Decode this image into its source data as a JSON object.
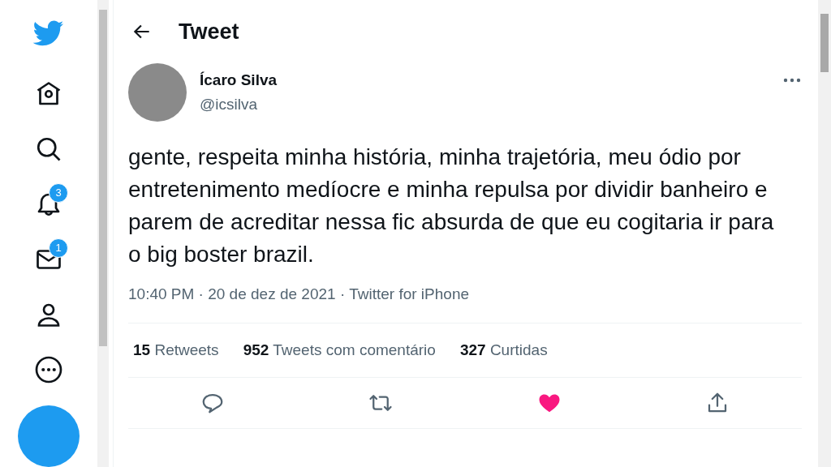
{
  "nav": [
    {
      "kind": "home"
    },
    {
      "kind": "search"
    },
    {
      "kind": "bell",
      "badge": "3"
    },
    {
      "kind": "mail",
      "badge": "1"
    },
    {
      "kind": "person"
    },
    {
      "kind": "more"
    }
  ],
  "header": {
    "title": "Tweet"
  },
  "tweet": {
    "name": "Ícaro Silva",
    "handle": "@icsilva",
    "text": "gente, respeita minha história, minha trajetória, meu ódio por entretenimento medíocre e minha repulsa por dividir banheiro e parem de acreditar nessa fic absurda de que eu cogitaria ir para o big boster brazil.",
    "meta": "10:40 PM · 20 de dez de 2021 · Twitter for iPhone"
  },
  "stats": [
    {
      "count": "15",
      "label": "Retweets"
    },
    {
      "count": "952",
      "label": "Tweets com comentário"
    },
    {
      "count": "327",
      "label": "Curtidas"
    }
  ],
  "actions": [
    {
      "kind": "reply",
      "selected": false
    },
    {
      "kind": "retweet",
      "selected": false
    },
    {
      "kind": "like",
      "selected": true
    },
    {
      "kind": "share",
      "selected": false
    }
  ]
}
